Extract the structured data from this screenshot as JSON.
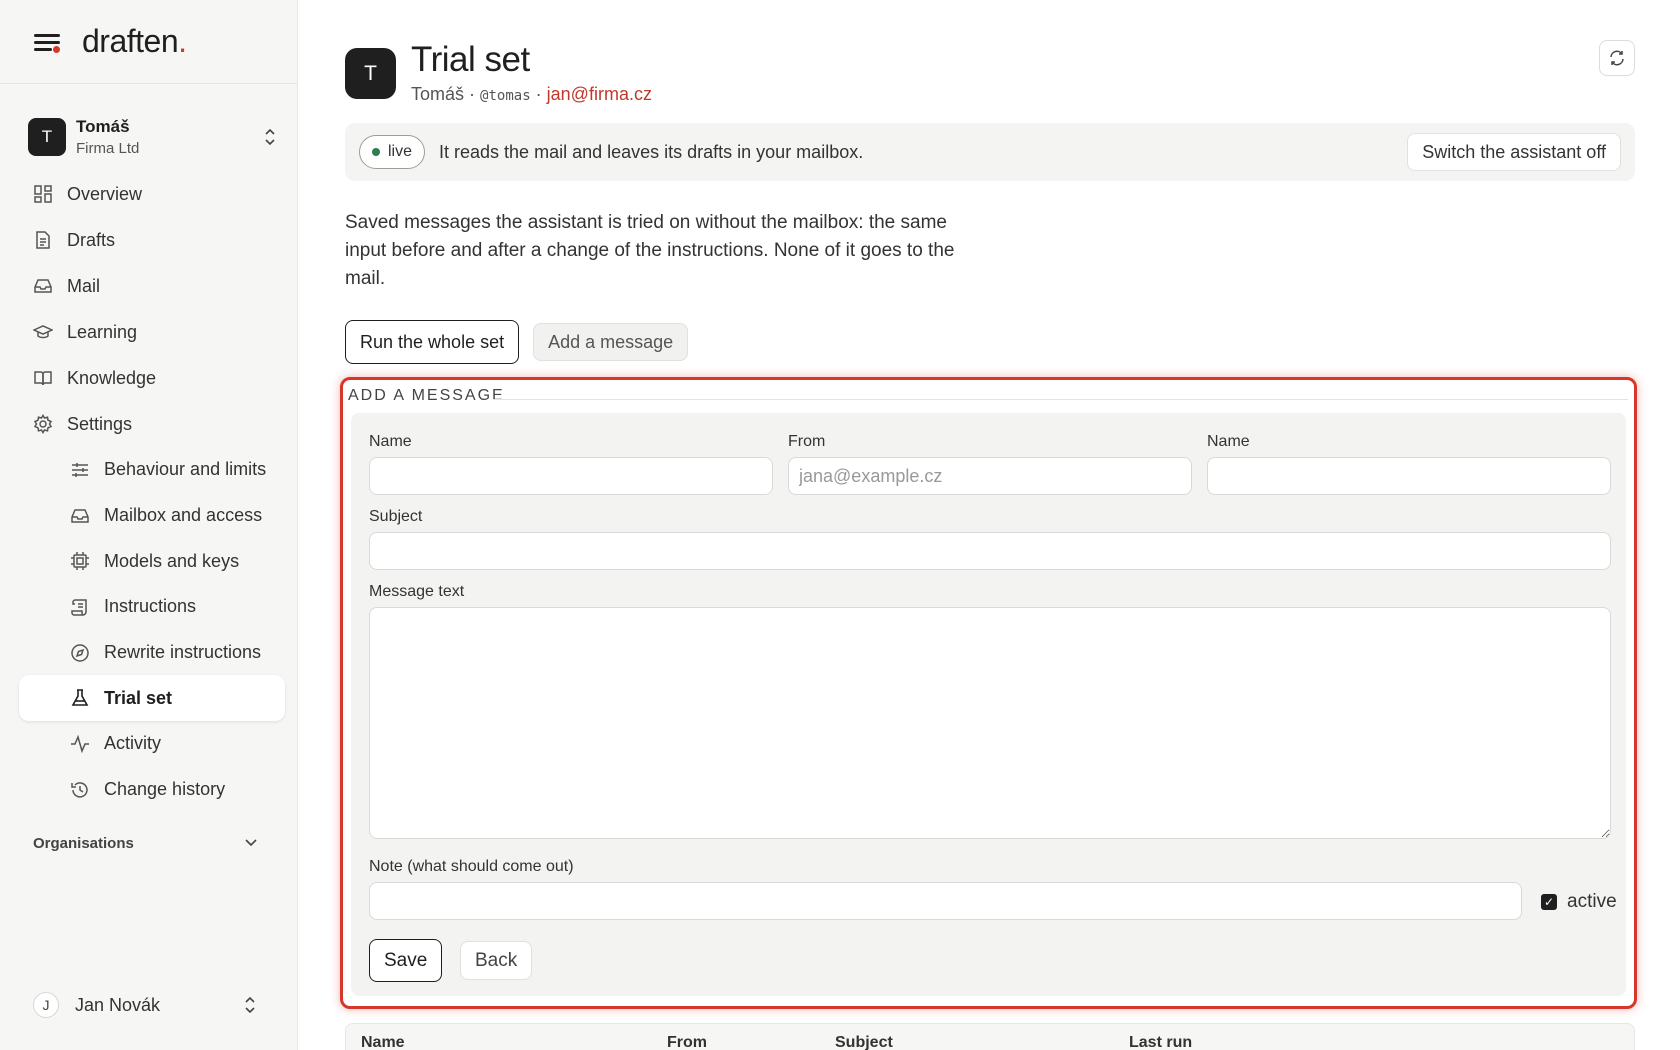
{
  "brand": {
    "name": "draften",
    "dot": "."
  },
  "account": {
    "initial": "T",
    "name": "Tomáš",
    "org": "Firma Ltd"
  },
  "nav": {
    "items": [
      {
        "label": "Overview"
      },
      {
        "label": "Drafts"
      },
      {
        "label": "Mail"
      },
      {
        "label": "Learning"
      },
      {
        "label": "Knowledge"
      },
      {
        "label": "Settings"
      }
    ],
    "settings": [
      {
        "label": "Behaviour and limits"
      },
      {
        "label": "Mailbox and access"
      },
      {
        "label": "Models and keys"
      },
      {
        "label": "Instructions"
      },
      {
        "label": "Rewrite instructions"
      },
      {
        "label": "Trial set"
      },
      {
        "label": "Activity"
      },
      {
        "label": "Change history"
      }
    ],
    "organisations": "Organisations"
  },
  "user": {
    "initial": "J",
    "name": "Jan Novák"
  },
  "header": {
    "initial": "T",
    "title": "Trial set",
    "owner": "Tomáš",
    "handle": "@tomas",
    "email": "jan@firma.cz",
    "sep": "·"
  },
  "banner": {
    "status": "live",
    "text": "It reads the mail and leaves its drafts in your mailbox.",
    "switch_label": "Switch the assistant off"
  },
  "description": "Saved messages the assistant is tried on without the mailbox: the same input before and after a change of the instructions. None of it goes to the mail.",
  "actions": {
    "run_label": "Run the whole set",
    "add_label": "Add a message"
  },
  "form": {
    "legend": "ADD A MESSAGE",
    "name_label": "Name",
    "from_label": "From",
    "from_placeholder": "jana@example.cz",
    "name2_label": "Name",
    "subject_label": "Subject",
    "body_label": "Message text",
    "note_label": "Note (what should come out)",
    "active_label": "active",
    "active_checked": true,
    "save_label": "Save",
    "back_label": "Back"
  },
  "table": {
    "columns": [
      "Name",
      "From",
      "Subject",
      "Last run"
    ]
  },
  "colors": {
    "accent": "#d7372b",
    "live": "#2e7d4f",
    "email": "#c0392b"
  }
}
